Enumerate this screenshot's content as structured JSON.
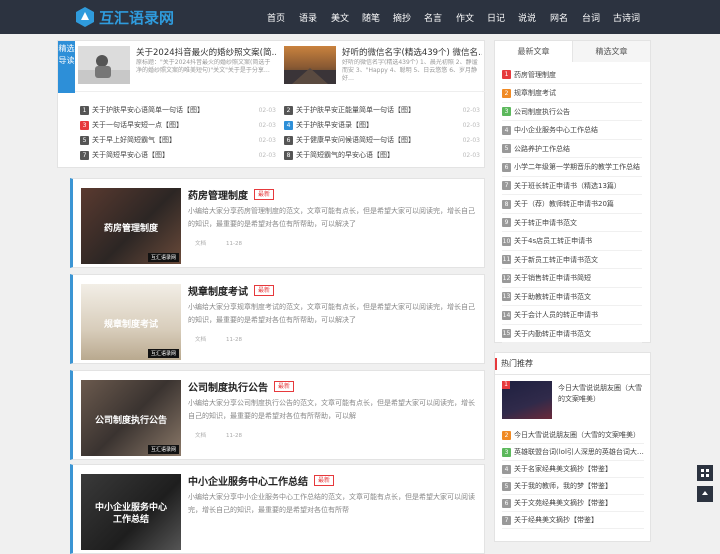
{
  "site": {
    "name": "互汇语录网"
  },
  "nav": [
    "首页",
    "语录",
    "美文",
    "随笔",
    "摘抄",
    "名言",
    "作文",
    "日记",
    "说说",
    "网名",
    "台词",
    "古诗词"
  ],
  "featured": {
    "tab_label": "精选导读",
    "cards": [
      {
        "title": "关于2024抖音最火的婚纱照文案(简…",
        "desc": "原标题：\"关于2024抖音最火的婚纱照文案(简选于净的婚纱照文案的唯美短句)\"关文\"关于是于分享…"
      },
      {
        "title": "好听的微信名字(精选439个) 微信名…",
        "desc": "好听的微信名字(精选439个) 1、晨光初照 2、静谧而安 3、\"Happy 4、聪明 5、日云悠悠 6、岁月静好…"
      }
    ],
    "list": [
      {
        "num": "1",
        "title": "关于护肤早安心语简单一句话【图】",
        "date": "02-03"
      },
      {
        "num": "2",
        "title": "关于护肤早安正能量简单一句话【图】",
        "date": "02-03"
      },
      {
        "num": "3",
        "title": "关于一句话早安短一点【图】",
        "date": "02-03"
      },
      {
        "num": "4",
        "title": "关于护肤早安语录【图】",
        "date": "02-03"
      },
      {
        "num": "5",
        "title": "关于早上好简短霸气【图】",
        "date": "02-03"
      },
      {
        "num": "6",
        "title": "关于健康早安问候语简短一句话【图】",
        "date": "02-03"
      },
      {
        "num": "7",
        "title": "关于简短早安心语【图】",
        "date": "02-03"
      },
      {
        "num": "8",
        "title": "关于简短霸气的早安心语【图】",
        "date": "02-03"
      }
    ]
  },
  "articles": [
    {
      "title": "药房管理制度",
      "badge": "最新",
      "image_label": "药房管理制度",
      "image_badge": "互汇语录网",
      "desc": "小编给大家分享药房管理制度的范文，文章可能有点长，但是希望大家可以阅读完，增长自己的知识，最重要的是希望对各位有所帮助，可以解决了",
      "category": "文档",
      "date": "11-28"
    },
    {
      "title": "规章制度考试",
      "badge": "最新",
      "image_label": "规章制度考试",
      "image_badge": "互汇语录网",
      "desc": "小编给大家分享规章制度考试的范文，文章可能有点长，但是希望大家可以阅读完，增长自己的知识，最重要的是希望对各位有所帮助，可以解决了",
      "category": "文档",
      "date": "11-28"
    },
    {
      "title": "公司制度执行公告",
      "badge": "最新",
      "image_label": "公司制度执行公告",
      "image_badge": "互汇语录网",
      "desc": "小编给大家分享公司制度执行公告的范文，文章可能有点长，但是希望大家可以阅读完，增长自己的知识，最重要的是希望对各位有所帮助，可以解",
      "category": "文档",
      "date": "11-28"
    },
    {
      "title": "中小企业服务中心工作总结",
      "badge": "最新",
      "image_label": "中小企业服务中心工作总结",
      "image_badge": "",
      "desc": "小编给大家分享中小企业服务中心工作总结的范文，文章可能有点长，但是希望大家可以阅读完，增长自己的知识，最重要的是希望对各位有所帮",
      "category": "",
      "date": ""
    }
  ],
  "sidebar_recent": {
    "tabs": [
      "最新文章",
      "精选文章"
    ],
    "items": [
      {
        "num": "1",
        "title": "药房管理制度"
      },
      {
        "num": "2",
        "title": "规章制度考试"
      },
      {
        "num": "3",
        "title": "公司制度执行公告"
      },
      {
        "num": "4",
        "title": "中小企业服务中心工作总结"
      },
      {
        "num": "5",
        "title": "公路养护工作总结"
      },
      {
        "num": "6",
        "title": "小学二年级第一学期音乐的教学工作总结"
      },
      {
        "num": "7",
        "title": "关于班长转正申请书（精选13篇）"
      },
      {
        "num": "8",
        "title": "关于（荐）教师转正申请书20篇"
      },
      {
        "num": "9",
        "title": "关于转正申请书范文"
      },
      {
        "num": "10",
        "title": "关于4s店员工转正申请书"
      },
      {
        "num": "11",
        "title": "关于新员工转正申请书范文"
      },
      {
        "num": "12",
        "title": "关于销售转正申请书简短"
      },
      {
        "num": "13",
        "title": "关于助教转正申请书范文"
      },
      {
        "num": "14",
        "title": "关于会计人员的转正申请书"
      },
      {
        "num": "15",
        "title": "关于内勤转正申请书范文"
      }
    ]
  },
  "sidebar_hot": {
    "heading": "热门推荐",
    "feature": {
      "num": "1",
      "title": "今日大雪说说朋友圈（大雪的文案唯美）"
    },
    "items": [
      {
        "num": "2",
        "title": "今日大雪说说朋友圈（大雪的文案唯美）"
      },
      {
        "num": "3",
        "title": "英雄联盟台词(lol引人深思的英雄台词大…"
      },
      {
        "num": "4",
        "title": "关于名家经典美文摘抄【带鉴】"
      },
      {
        "num": "5",
        "title": "关于我的教师，我的梦【带鉴】"
      },
      {
        "num": "6",
        "title": "关于文苑经典美文摘抄【带鉴】"
      },
      {
        "num": "7",
        "title": "关于经典美文摘抄【带鉴】"
      }
    ]
  },
  "colors": {
    "accent": "#2d8fd8",
    "nav_bg": "#2c3340",
    "rank1": "#e6393c",
    "rank2": "#f08a24",
    "rank3": "#5cb85c",
    "rank_other": "#999999",
    "badge_new": "#e6393c"
  }
}
